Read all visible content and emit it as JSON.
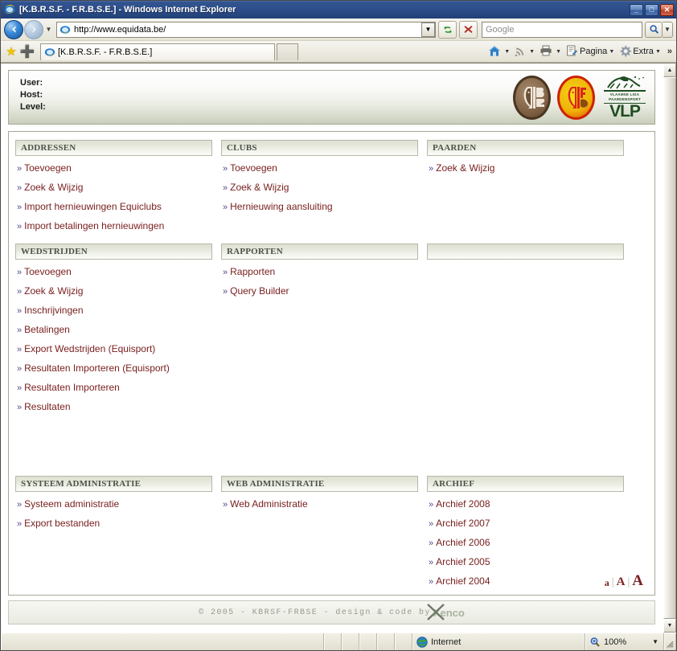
{
  "window": {
    "title": "[K.B.R.S.F. - F.R.B.S.E.] - Windows Internet Explorer",
    "minimize_label": "_",
    "maximize_label": "□",
    "close_label": "✕",
    "ie_icon": "internet-explorer-icon"
  },
  "toolbar": {
    "back_label": "←",
    "forward_label": "→",
    "history_caret": "▼",
    "url_value": "http://www.equidata.be/",
    "url_dropdown_caret": "▼",
    "refresh_label": "↻",
    "stop_label": "✕",
    "search_placeholder": "Google",
    "search_value": "",
    "search_icon": "magnifier-icon",
    "search_caret": "▼"
  },
  "tabbar": {
    "favorites_star": "★",
    "add_favorite": "➕",
    "tab_title": "[K.B.R.S.F. - F.R.B.S.E.]",
    "new_tab_label": "",
    "commands": [
      {
        "name": "home",
        "icon": "home-icon",
        "glyph": "⌂",
        "label": "",
        "caret": "▼"
      },
      {
        "name": "feeds",
        "icon": "rss-icon",
        "glyph": "◔",
        "label": "",
        "caret": "▼"
      },
      {
        "name": "print",
        "icon": "printer-icon",
        "glyph": "⎙",
        "label": "",
        "caret": "▼"
      },
      {
        "name": "page",
        "icon": "page-icon",
        "glyph": "὜b",
        "label": "Pagina",
        "caret": "▼"
      },
      {
        "name": "tools",
        "icon": "gear-icon",
        "glyph": "⚙",
        "label": "Extra",
        "caret": "▼"
      }
    ],
    "overflow_label": "»"
  },
  "site": {
    "header": {
      "user_label": "User:",
      "host_label": "Host:",
      "level_label": "Level:",
      "user_value": "",
      "host_value": "",
      "level_value": "",
      "logos": [
        {
          "name": "kbrsf-logo",
          "letters": "℘"
        },
        {
          "name": "frbse-logo",
          "letters": "℘"
        },
        {
          "name": "vlp-logo",
          "sub": "VLAAMSE LIGA PAARDENSPORT",
          "title": "VLP"
        }
      ]
    },
    "sections": [
      {
        "id": "addressen",
        "title": "ADDRESSEN",
        "links": [
          "Toevoegen",
          "Zoek & Wijzig",
          "Import hernieuwingen Equiclubs",
          "Import betalingen hernieuwingen"
        ]
      },
      {
        "id": "clubs",
        "title": "CLUBS",
        "links": [
          "Toevoegen",
          "Zoek & Wijzig",
          "Hernieuwing aansluiting"
        ]
      },
      {
        "id": "paarden",
        "title": "PAARDEN",
        "links": [
          "Zoek & Wijzig"
        ]
      },
      {
        "id": "wedstrijden",
        "title": "WEDSTRIJDEN",
        "links": [
          "Toevoegen",
          "Zoek & Wijzig",
          "Inschrijvingen",
          "Betalingen",
          "Export Wedstrijden (Equisport)",
          "Resultaten Importeren (Equisport)",
          "Resultaten Importeren",
          "Resultaten"
        ]
      },
      {
        "id": "rapporten",
        "title": "RAPPORTEN",
        "links": [
          "Rapporten",
          "Query Builder"
        ]
      },
      {
        "id": "empty",
        "title": "",
        "links": []
      },
      {
        "id": "systeem-administratie",
        "title": "SYSTEEM ADMINISTRATIE",
        "links": [
          "Systeem administratie",
          "Export bestanden"
        ]
      },
      {
        "id": "web-administratie",
        "title": "WEB ADMINISTRATIE",
        "links": [
          "Web Administratie"
        ]
      },
      {
        "id": "archief",
        "title": "ARCHIEF",
        "links": [
          "Archief 2008",
          "Archief 2007",
          "Archief 2006",
          "Archief 2005",
          "Archief 2004"
        ]
      }
    ],
    "bullet": "»",
    "font_size": {
      "small": "a",
      "medium": "A",
      "large": "A",
      "separator": "|"
    },
    "footer": {
      "copyright": "© 2005 - KBRSF-FRBSE - design & code by",
      "brand": "Xenco"
    }
  },
  "statusbar": {
    "message": "",
    "zone_label": "Internet",
    "zone_icon": "globe-icon",
    "zoom_label": "100%",
    "zoom_icon": "magnifier-plus-icon",
    "zoom_caret": "▼"
  },
  "scrollbar": {
    "up_arrow": "▲",
    "down_arrow": "▼"
  },
  "colors": {
    "title_bar": "#2d4e8a",
    "link": "#7a2020",
    "section_head_text": "#4e5348",
    "bullet": "#5a4a8a"
  }
}
